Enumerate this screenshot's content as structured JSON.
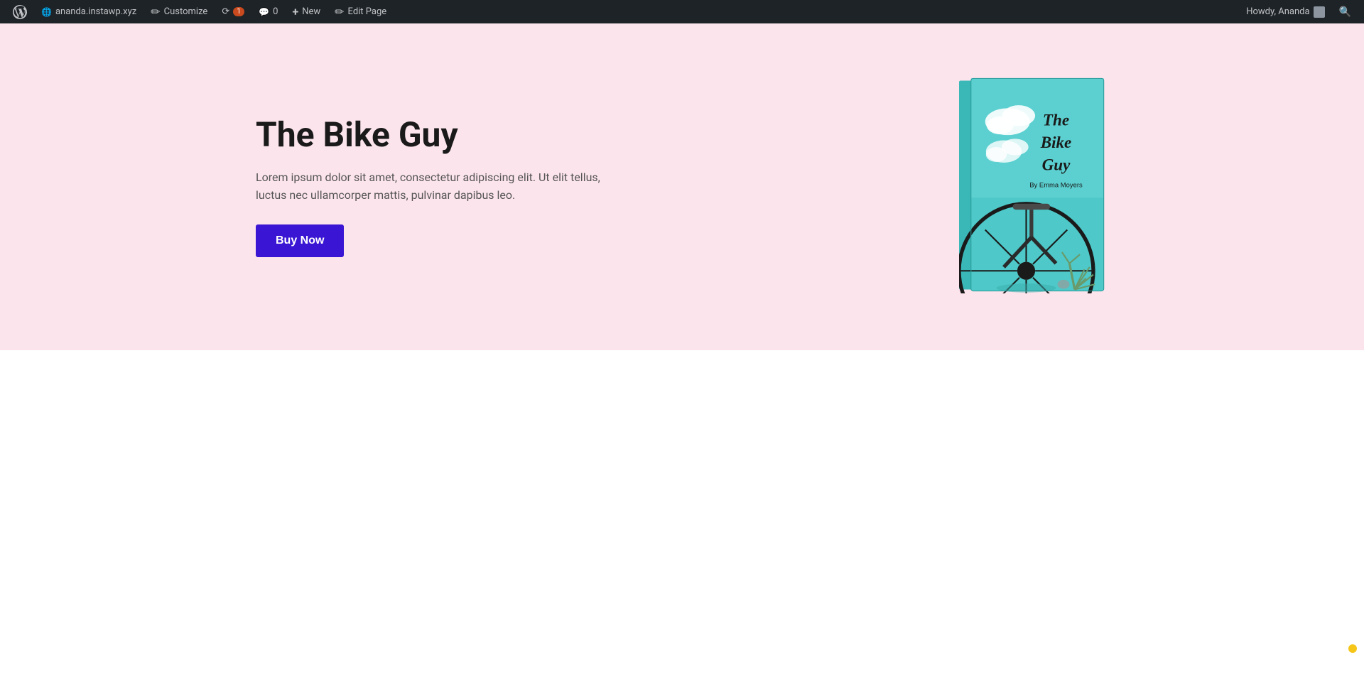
{
  "adminbar": {
    "wp_logo_title": "WordPress",
    "site_name": "ananda.instawp.xyz",
    "customize_label": "Customize",
    "updates_count": "1",
    "comments_count": "0",
    "new_label": "New",
    "edit_page_label": "Edit Page",
    "howdy_text": "Howdy, Ananda",
    "search_icon": "search"
  },
  "hero": {
    "title": "The Bike Guy",
    "description": "Lorem ipsum dolor sit amet, consectetur adipiscing elit. Ut elit tellus, luctus nec ullamcorper mattis, pulvinar dapibus leo.",
    "buy_button_label": "Buy Now",
    "book_title_line1": "The",
    "book_title_line2": "Bike",
    "book_title_line3": "Guy",
    "book_author": "By Emma Moyers",
    "background_color": "#fce4ec",
    "book_bg_color": "#4ec8c8",
    "button_color": "#3a16d4"
  },
  "below_hero": {
    "background": "#ffffff"
  }
}
